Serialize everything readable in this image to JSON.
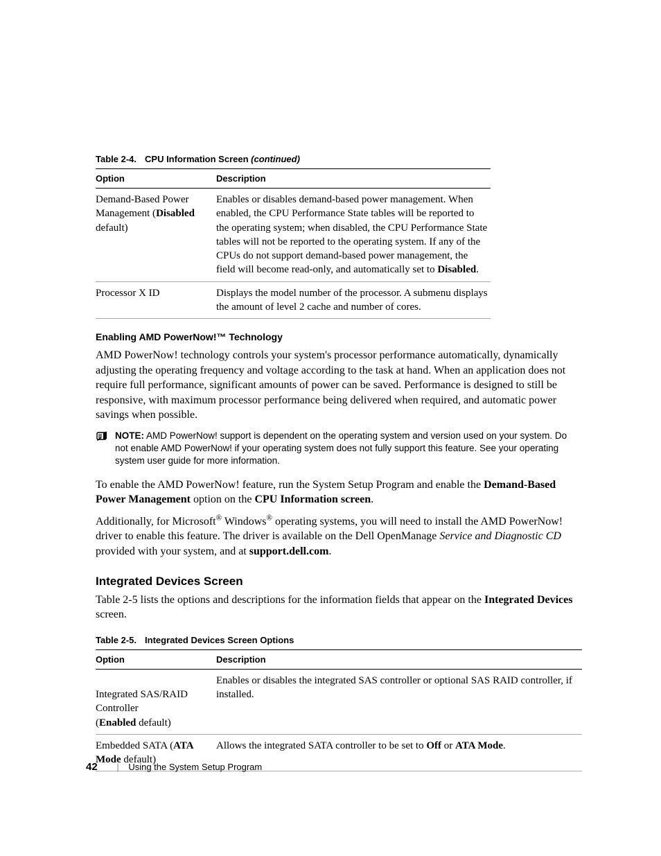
{
  "table1": {
    "caption_num": "Table 2-4.",
    "caption_title": "CPU Information Screen ",
    "caption_suffix": "(continued)",
    "col_option": "Option",
    "col_description": "Description",
    "rows": [
      {
        "opt_pre": "Demand-Based Power Management (",
        "opt_bold": "Disabled",
        "opt_post": " default)",
        "desc_pre": "Enables or disables demand-based power management. When enabled, the CPU Performance State tables will be reported to the operating system; when disabled, the CPU Performance State tables will not be reported to the operating system. If any of the CPUs do not support demand-based power management, the field will become read-only, and automatically set to ",
        "desc_bold": "Disabled",
        "desc_post": "."
      },
      {
        "opt_pre": "Processor X ID",
        "opt_bold": "",
        "opt_post": "",
        "desc_pre": "Displays the model number of the processor. A submenu displays the amount of level 2 cache and number of cores.",
        "desc_bold": "",
        "desc_post": ""
      }
    ]
  },
  "sub1_title": "Enabling AMD PowerNow!™ Technology",
  "para1": "AMD PowerNow! technology controls your system's processor performance automatically, dynamically adjusting the operating frequency and voltage according to the task at hand. When an application does not require full performance, significant amounts of power can be saved. Performance is designed to still be responsive, with maximum processor performance being delivered when required, and automatic power savings when possible.",
  "note": {
    "label": "NOTE:",
    "text": " AMD PowerNow! support is dependent on the operating system and version used on your system. Do not enable AMD PowerNow! if your operating system does not fully support this feature. See your operating system user guide for more information."
  },
  "para2": {
    "t0": "To enable the AMD PowerNow! feature, run the System Setup Program and enable the ",
    "b0": "Demand-Based Power Management",
    "t1": " option on the ",
    "b1": "CPU Information screen",
    "t2": "."
  },
  "para3": {
    "t0": "Additionally, for Microsoft",
    "sup0": "®",
    "t1": " Windows",
    "sup1": "®",
    "t2": " operating systems, you will need to install the AMD PowerNow! driver to enable this feature. The driver is available on the Dell OpenManage ",
    "i0": "Service and Diagnostic CD",
    "t3": " provided with your system, and at ",
    "b0": "support.dell.com",
    "t4": "."
  },
  "section2_title": "Integrated Devices Screen",
  "para4": {
    "t0": "Table 2-5 lists the options and descriptions for the information fields that appear on the ",
    "b0": "Integrated Devices",
    "t1": " screen."
  },
  "table2": {
    "caption_num": "Table 2-5.",
    "caption_title": "Integrated Devices Screen Options",
    "col_option": "Option",
    "col_description": "Description",
    "rows": [
      {
        "opt_pre": "Integrated SAS/RAID Controller\n(",
        "opt_bold": "Enabled",
        "opt_post": " default)",
        "desc_pre": "Enables or disables the integrated SAS controller or optional SAS RAID controller, if installed.",
        "desc_bold": "",
        "desc_post": ""
      },
      {
        "opt_pre": "Embedded SATA (",
        "opt_bold": "ATA Mode",
        "opt_post": " default)",
        "desc_pre": "Allows the integrated SATA controller to be set to ",
        "desc_bold": "Off",
        "desc_mid": " or ",
        "desc_bold2": "ATA Mode",
        "desc_post": "."
      }
    ]
  },
  "footer": {
    "page": "42",
    "sep": "|",
    "title": "Using the System Setup Program"
  }
}
